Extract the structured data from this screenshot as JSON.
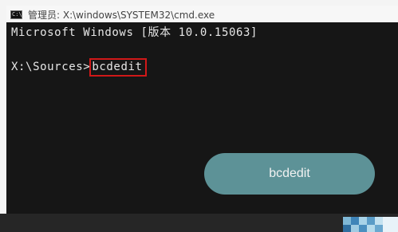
{
  "window": {
    "title": "管理员: X:\\windows\\SYSTEM32\\cmd.exe",
    "icon": "cmd-console-icon",
    "icon_text": "C:\\"
  },
  "console": {
    "line1": "Microsoft Windows [版本 10.0.15063]",
    "prompt": "X:\\Sources>",
    "command": "bcdedit"
  },
  "overlay": {
    "label": "bcdedit",
    "color": "#5d9297"
  },
  "colors": {
    "console_bg": "#161616",
    "console_text": "#e6e6e6",
    "highlight_border": "#d01818"
  }
}
